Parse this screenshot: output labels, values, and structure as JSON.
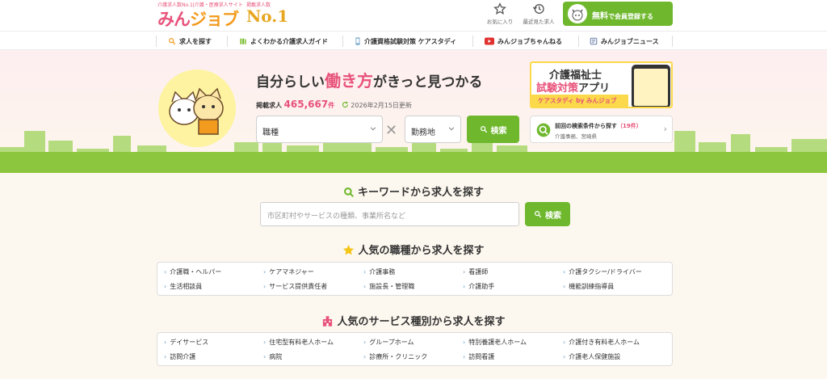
{
  "header": {
    "logo_tagline": "介護求人数No.1|介護・医療求人サイト",
    "logo_main_1": "みん",
    "logo_main_2": "ジョブ",
    "no1_tagline": "掲載求人数",
    "no1_text": "No.1",
    "favorites_label": "お気に入り",
    "recent_label": "最近見た求人",
    "register_free": "無料",
    "register_rest": "で会員登録する"
  },
  "nav": {
    "items": [
      {
        "label": "求人を探す",
        "icon": "search-icon"
      },
      {
        "label": "よくわかる介護求人ガイド",
        "icon": "books-icon"
      },
      {
        "label": "介護資格試験対策 ケアスタディ",
        "icon": "phone-icon"
      },
      {
        "label": "みんジョブちゃんねる",
        "icon": "video-icon"
      },
      {
        "label": "みんジョブニュース",
        "icon": "news-icon"
      }
    ]
  },
  "hero": {
    "title_pre": "自分らしい",
    "title_hl": "働き方",
    "title_post": "がきっと見つかる",
    "count_label": "掲載求人",
    "count_value": "465,667",
    "count_unit": "件",
    "updated": "2026年2月15日更新",
    "occupation_select": "職種",
    "location_select": "勤務地",
    "search_button": "検索",
    "app_ad_line1": "介護福祉士",
    "app_ad_line2_hl": "試験対策",
    "app_ad_line2_rest": "アプリ",
    "app_ad_bar": "ケアスタディ by みんジョブ",
    "recent_search_title": "前回の検索条件から探す",
    "recent_search_count": "（19件）",
    "recent_search_sub": "介護事務、宮崎県"
  },
  "keyword": {
    "title": "キーワードから求人を探す",
    "placeholder": "市区町村やサービスの種類、事業所名など",
    "button": "検索"
  },
  "popular_jobs": {
    "title": "人気の職種から求人を探す",
    "row1": [
      "介護職・ヘルパー",
      "ケアマネジャー",
      "介護事務",
      "看護師",
      "介護タクシー/ドライバー"
    ],
    "row2": [
      "生活相談員",
      "サービス提供責任者",
      "施設長・管理職",
      "介護助手",
      "機能訓練指導員"
    ]
  },
  "popular_services": {
    "title": "人気のサービス種別から求人を探す",
    "row1": [
      "デイサービス",
      "住宅型有料老人ホーム",
      "グループホーム",
      "特別養護老人ホーム",
      "介護付き有料老人ホーム"
    ],
    "row2": [
      "訪問介護",
      "病院",
      "診療所・クリニック",
      "訪問看護",
      "介護老人保健施設"
    ]
  },
  "colors": {
    "brand_pink": "#e8527a",
    "brand_orange": "#f29b1e",
    "accent_green": "#6fb82e"
  }
}
